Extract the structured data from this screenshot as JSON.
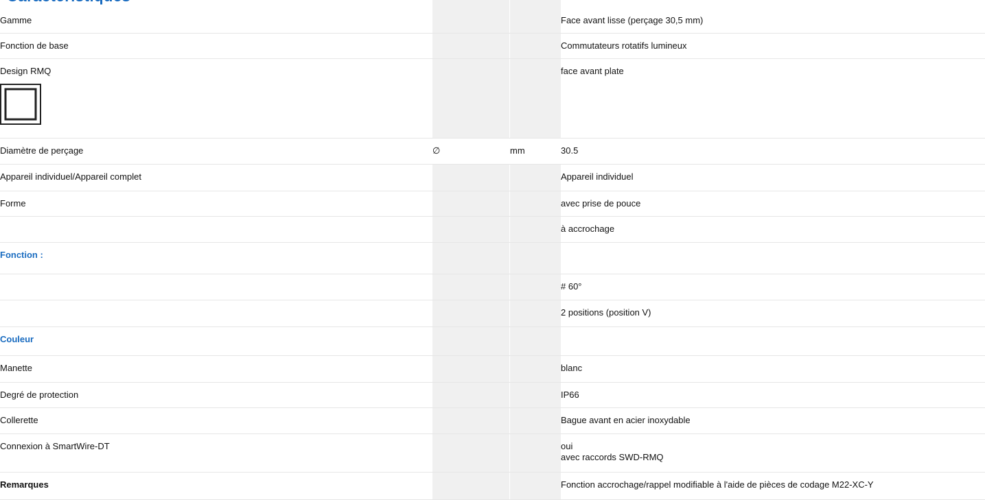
{
  "heading": "Caractéristiques",
  "rows": {
    "gamme": {
      "label": "Gamme",
      "value": "Face avant lisse (perçage 30,5 mm)"
    },
    "fonction_base": {
      "label": "Fonction de base",
      "value": "Commutateurs rotatifs lumineux"
    },
    "design": {
      "label": "Design RMQ",
      "value": "face avant plate",
      "icon": "flat-front-icon"
    },
    "diametre": {
      "label": "Diamètre de perçage",
      "symbol": "∅",
      "unit": "mm",
      "value": "30.5"
    },
    "appareil": {
      "label": "Appareil individuel/Appareil complet",
      "value": "Appareil individuel"
    },
    "forme": {
      "label": "Forme",
      "value": "avec prise de pouce"
    },
    "forme2": {
      "value": "à accrochage"
    },
    "fonction_section": {
      "label": "Fonction :"
    },
    "angle": {
      "value": "# 60°"
    },
    "positions": {
      "value": "2 positions (position V)"
    },
    "couleur_section": {
      "label": "Couleur"
    },
    "manette": {
      "label": "Manette",
      "value": "blanc"
    },
    "protection": {
      "label": "Degré de protection",
      "value": "IP66"
    },
    "collerette": {
      "label": "Collerette",
      "value": "Bague avant en acier inoxydable"
    },
    "connexion": {
      "label": "Connexion à SmartWire-DT",
      "value": "oui",
      "value2": "avec raccords SWD-RMQ"
    },
    "remarques": {
      "label": "Remarques",
      "value": "Fonction accrochage/rappel modifiable à l'aide de pièces de codage M22-XC-Y"
    }
  },
  "colors": {
    "accent": "#1a6cc0",
    "band": "#f0f0f0",
    "rule": "#e6e6e6"
  }
}
